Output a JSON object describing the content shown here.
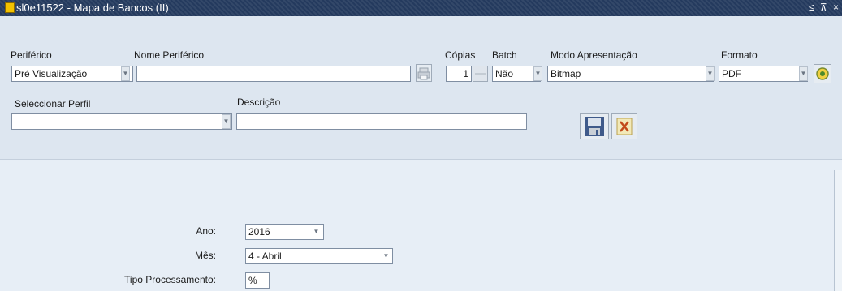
{
  "window": {
    "title": "sl0e11522 - Mapa de Bancos (II)",
    "controls": "≤ ⊼ ×"
  },
  "labels": {
    "periferico": "Periférico",
    "nome_periferico": "Nome Periférico",
    "copias": "Cópias",
    "batch": "Batch",
    "modo_apresentacao": "Modo Apresentação",
    "formato": "Formato",
    "seleccionar_perfil": "Seleccionar Perfil",
    "descricao": "Descrição"
  },
  "values": {
    "periferico": "Pré Visualização",
    "nome_periferico": "",
    "copias": "1",
    "batch": "Não",
    "modo_apresentacao": "Bitmap",
    "formato": "PDF",
    "seleccionar_perfil": "",
    "descricao": ""
  },
  "params": {
    "ano_label": "Ano:",
    "ano_value": "2016",
    "mes_label": "Mês:",
    "mes_value": "4 - Abril",
    "tipo_label": "Tipo Processamento:",
    "tipo_value": "%"
  },
  "icons": {
    "printer": "printer-icon",
    "stepper": "stepper-icon",
    "help": "help-icon",
    "save": "save-icon",
    "delete": "delete-icon",
    "dropdown": "chevron-down-icon"
  }
}
